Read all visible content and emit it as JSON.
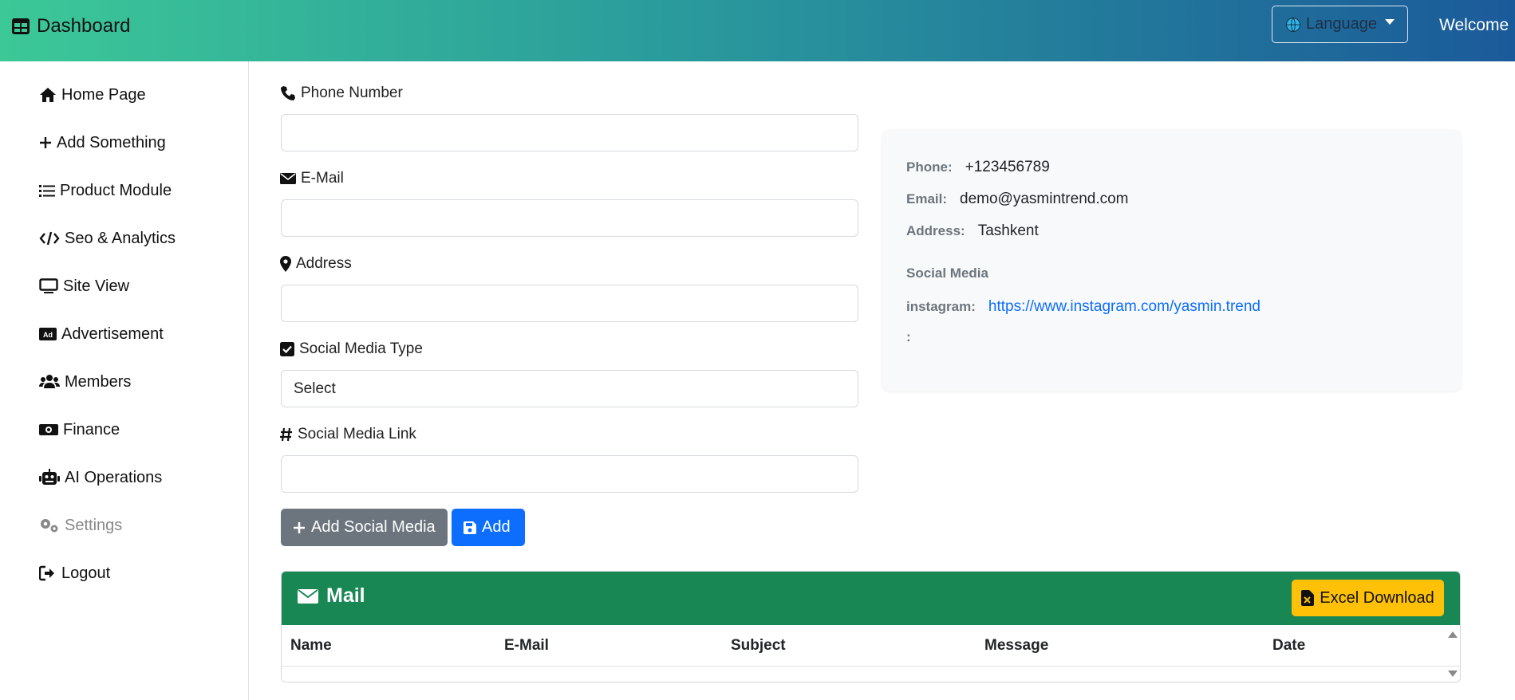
{
  "header": {
    "brand": "Dashboard",
    "language_label": "Language",
    "welcome": "Welcome"
  },
  "sidebar": {
    "items": [
      {
        "label": "Home Page",
        "icon": "home-icon"
      },
      {
        "label": "Add Something",
        "icon": "plus-icon"
      },
      {
        "label": "Product Module",
        "icon": "list-icon"
      },
      {
        "label": "Seo & Analytics",
        "icon": "code-icon"
      },
      {
        "label": "Site View",
        "icon": "desktop-icon"
      },
      {
        "label": "Advertisement",
        "icon": "ad-icon"
      },
      {
        "label": "Members",
        "icon": "users-icon"
      },
      {
        "label": "Finance",
        "icon": "money-icon"
      },
      {
        "label": "AI Operations",
        "icon": "robot-icon"
      },
      {
        "label": "Settings",
        "icon": "gears-icon"
      },
      {
        "label": "Logout",
        "icon": "logout-icon"
      }
    ]
  },
  "form": {
    "phone_label": "Phone Number",
    "phone_value": "",
    "email_label": "E-Mail",
    "email_value": "",
    "address_label": "Address",
    "address_value": "",
    "social_type_label": "Social Media Type",
    "social_type_selected": "Select",
    "social_link_label": "Social Media Link",
    "social_link_value": "",
    "add_social_button": "Add Social Media",
    "add_button": "Add"
  },
  "contact_info": {
    "phone_key": "Phone:",
    "phone": "+123456789",
    "email_key": "Email:",
    "email": "demo@yasmintrend.com",
    "address_key": "Address:",
    "address": "Tashkent",
    "social_heading": "Social Media",
    "social_items": [
      {
        "key": "instagram:",
        "value": "https://www.instagram.com/yasmin.trend"
      },
      {
        "key": ":",
        "value": ""
      }
    ]
  },
  "mail": {
    "title": "Mail",
    "excel_button": "Excel Download",
    "columns": [
      "Name",
      "E-Mail",
      "Subject",
      "Message",
      "Date"
    ]
  },
  "colors": {
    "header_gradient_start": "#3cc897",
    "header_gradient_end": "#1b5a9a",
    "primary": "#0d6efd",
    "secondary": "#6c757d",
    "success": "#198754",
    "warning": "#ffc107"
  }
}
